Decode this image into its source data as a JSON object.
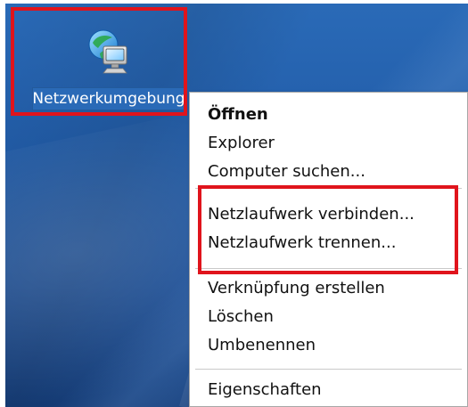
{
  "desktop": {
    "icon": {
      "name": "network-neighborhood-icon",
      "label": "Netzwerkumgebung"
    }
  },
  "context_menu": {
    "items": [
      {
        "label": "Öffnen",
        "bold": true
      },
      {
        "label": "Explorer"
      },
      {
        "label": "Computer suchen..."
      },
      {
        "label": "Netzlaufwerk verbinden..."
      },
      {
        "label": "Netzlaufwerk trennen..."
      },
      {
        "label": "Verknüpfung erstellen"
      },
      {
        "label": "Löschen"
      },
      {
        "label": "Umbenennen"
      },
      {
        "label": "Eigenschaften"
      }
    ]
  },
  "highlight_color": "#e0141c",
  "desktop_color": "#225da9",
  "selection_color": "#2a6ab7"
}
